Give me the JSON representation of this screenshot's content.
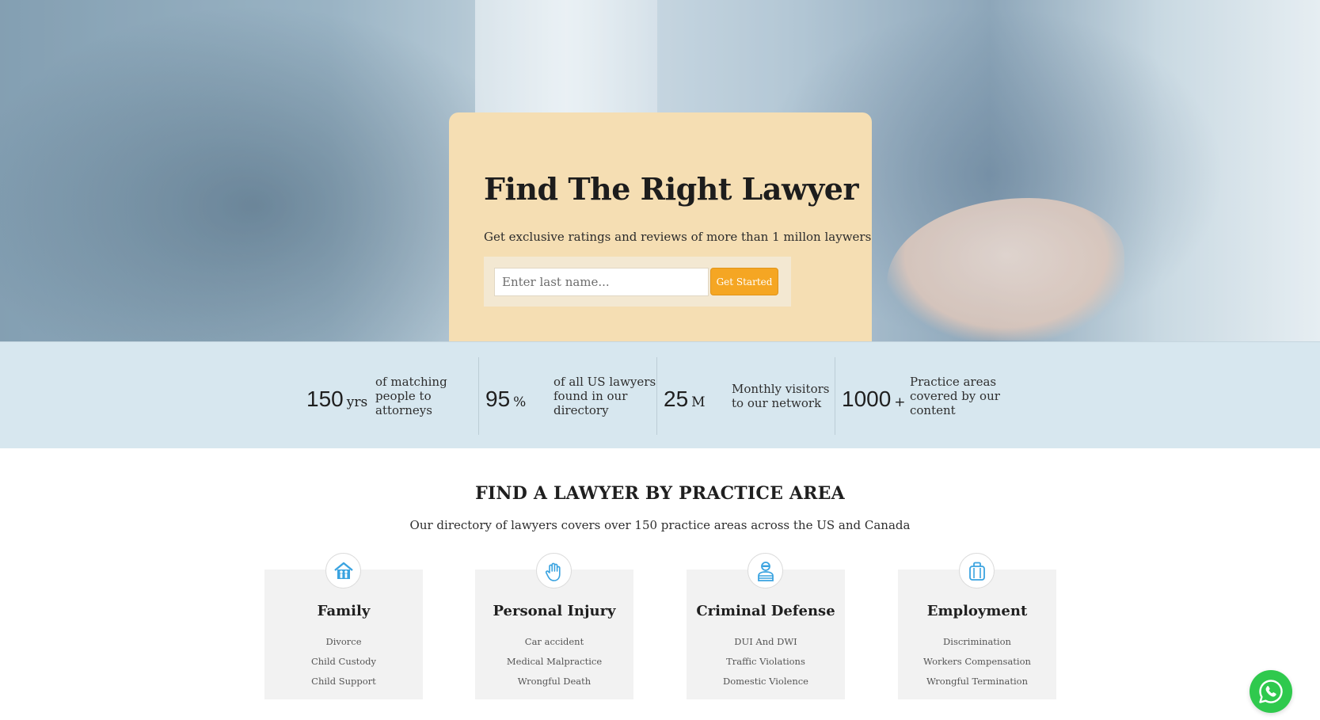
{
  "hero": {
    "title": "Find The Right Lawyer",
    "subtitle": "Get exclusive ratings and reviews of more than 1 millon laywers",
    "search_placeholder": "Enter last name...",
    "cta_label": "Get Started",
    "card_color": "#f5deb3",
    "cta_color": "#f5a623"
  },
  "stats": [
    {
      "number": "150",
      "unit": "yrs",
      "description": "of matching people to attorneys"
    },
    {
      "number": "95",
      "unit": "%",
      "description": "of all US lawyers found in our directory"
    },
    {
      "number": "25",
      "unit": "M",
      "description": "Monthly visitors to our network"
    },
    {
      "number": "1000",
      "unit": "+",
      "description": "Practice areas covered by our content"
    }
  ],
  "practice": {
    "title": "FIND A LAWYER BY PRACTICE AREA",
    "subtitle": "Our directory of lawyers covers over 150 practice areas across the US and Canada",
    "icon_color": "#3aa3e0",
    "cards": [
      {
        "icon": "family-house-icon",
        "title": "Family",
        "links": [
          "Divorce",
          "Child Custody",
          "Child Support"
        ]
      },
      {
        "icon": "hand-injury-icon",
        "title": "Personal Injury",
        "links": [
          "Car accident",
          "Medical Malpractice",
          "Wrongful Death"
        ]
      },
      {
        "icon": "prisoner-icon",
        "title": "Criminal Defense",
        "links": [
          "DUI And DWI",
          "Traffic Violations",
          "Domestic Violence"
        ]
      },
      {
        "icon": "briefcase-icon",
        "title": "Employment",
        "links": [
          "Discrimination",
          "Workers Compensation",
          "Wrongful Termination"
        ]
      }
    ]
  },
  "whatsapp": {
    "icon": "whatsapp-icon",
    "color": "#2fc94d"
  }
}
